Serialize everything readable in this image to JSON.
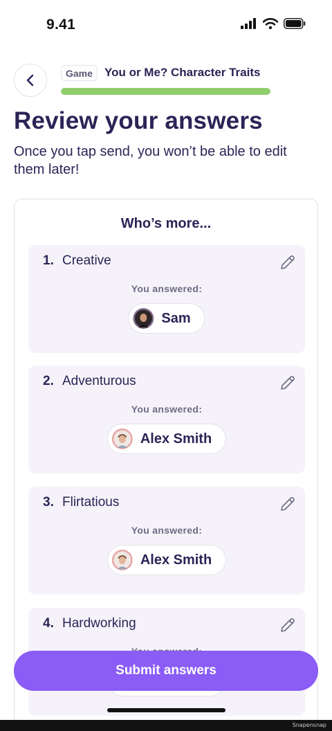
{
  "status_bar": {
    "time": "9.41"
  },
  "header": {
    "badge": "Game",
    "title": "You or Me? Character Traits",
    "progress": 1.0
  },
  "page": {
    "title": "Review your answers",
    "subtitle": "Once you tap send, you won’t be able to edit them later!"
  },
  "card": {
    "heading": "Who’s more...",
    "questions": [
      {
        "number": "1.",
        "label": "Creative",
        "answered_label": "You answered:",
        "answer": "Sam"
      },
      {
        "number": "2.",
        "label": "Adventurous",
        "answered_label": "You answered:",
        "answer": "Alex Smith"
      },
      {
        "number": "3.",
        "label": "Flirtatious",
        "answered_label": "You answered:",
        "answer": "Alex Smith"
      },
      {
        "number": "4.",
        "label": "Hardworking",
        "answered_label": "You answered:",
        "answer": ""
      }
    ]
  },
  "submit_label": "Submit answers",
  "watermark": "Snapensnap",
  "colors": {
    "accent": "#8b5cf6",
    "progress": "#8fce6b",
    "text": "#2b2456"
  }
}
